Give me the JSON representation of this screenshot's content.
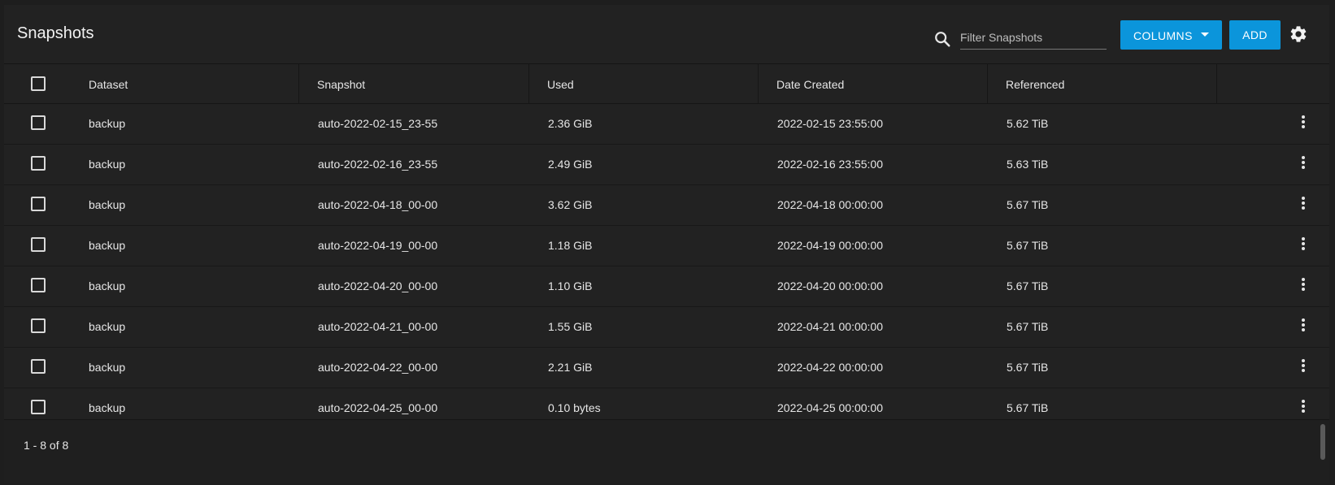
{
  "page": {
    "title": "Snapshots"
  },
  "toolbar": {
    "search_placeholder": "Filter Snapshots",
    "search_value": "",
    "columns_label": "COLUMNS",
    "add_label": "ADD",
    "accent_color": "#0b95db"
  },
  "table": {
    "columns": [
      "Dataset",
      "Snapshot",
      "Used",
      "Date Created",
      "Referenced"
    ],
    "rows": [
      {
        "dataset": "backup",
        "snapshot": "auto-2022-02-15_23-55",
        "used": "2.36 GiB",
        "created": "2022-02-15 23:55:00",
        "referenced": "5.62 TiB"
      },
      {
        "dataset": "backup",
        "snapshot": "auto-2022-02-16_23-55",
        "used": "2.49 GiB",
        "created": "2022-02-16 23:55:00",
        "referenced": "5.63 TiB"
      },
      {
        "dataset": "backup",
        "snapshot": "auto-2022-04-18_00-00",
        "used": "3.62 GiB",
        "created": "2022-04-18 00:00:00",
        "referenced": "5.67 TiB"
      },
      {
        "dataset": "backup",
        "snapshot": "auto-2022-04-19_00-00",
        "used": "1.18 GiB",
        "created": "2022-04-19 00:00:00",
        "referenced": "5.67 TiB"
      },
      {
        "dataset": "backup",
        "snapshot": "auto-2022-04-20_00-00",
        "used": "1.10 GiB",
        "created": "2022-04-20 00:00:00",
        "referenced": "5.67 TiB"
      },
      {
        "dataset": "backup",
        "snapshot": "auto-2022-04-21_00-00",
        "used": "1.55 GiB",
        "created": "2022-04-21 00:00:00",
        "referenced": "5.67 TiB"
      },
      {
        "dataset": "backup",
        "snapshot": "auto-2022-04-22_00-00",
        "used": "2.21 GiB",
        "created": "2022-04-22 00:00:00",
        "referenced": "5.67 TiB"
      },
      {
        "dataset": "backup",
        "snapshot": "auto-2022-04-25_00-00",
        "used": "0.10 bytes",
        "created": "2022-04-25 00:00:00",
        "referenced": "5.67 TiB"
      }
    ]
  },
  "footer": {
    "paging": "1 - 8 of 8"
  },
  "icons": {
    "search": "search-icon",
    "columns_dropdown": "caret-down-icon",
    "settings": "gear-icon",
    "row_menu": "more-vert-icon",
    "select": "checkbox-icon"
  }
}
